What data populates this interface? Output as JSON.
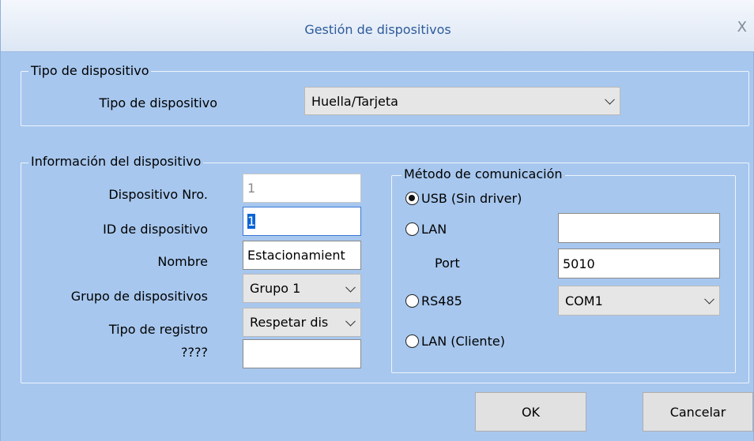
{
  "window": {
    "title": "Gestión de dispositivos",
    "close_glyph": "X"
  },
  "device_type_group": {
    "legend": "Tipo de dispositivo",
    "label": "Tipo de dispositivo",
    "selected": "Huella/Tarjeta"
  },
  "device_info": {
    "legend": "Información del dispositivo",
    "number": {
      "label": "Dispositivo Nro.",
      "value": "1"
    },
    "device_id": {
      "label": "ID de dispositivo",
      "value": "1"
    },
    "name": {
      "label": "Nombre",
      "value": "Estacionamient"
    },
    "group": {
      "label": "Grupo de dispositivos",
      "selected": "Grupo 1"
    },
    "record_type": {
      "label": "Tipo de registro",
      "selected": "Respetar dis"
    },
    "unknown": {
      "label": "????",
      "value": ""
    }
  },
  "comm": {
    "legend": "Método de comunicación",
    "usb": {
      "label": "USB (Sin driver)",
      "checked": true
    },
    "lan": {
      "label": "LAN",
      "value": ""
    },
    "port": {
      "label": "Port",
      "value": "5010"
    },
    "rs485": {
      "label": "RS485",
      "selected": "COM1"
    },
    "lan_client": {
      "label": "LAN (Cliente)"
    }
  },
  "buttons": {
    "ok": "OK",
    "cancel": "Cancelar"
  },
  "icons": {
    "close": "close-icon",
    "dropdown": "chevron-down-icon"
  }
}
